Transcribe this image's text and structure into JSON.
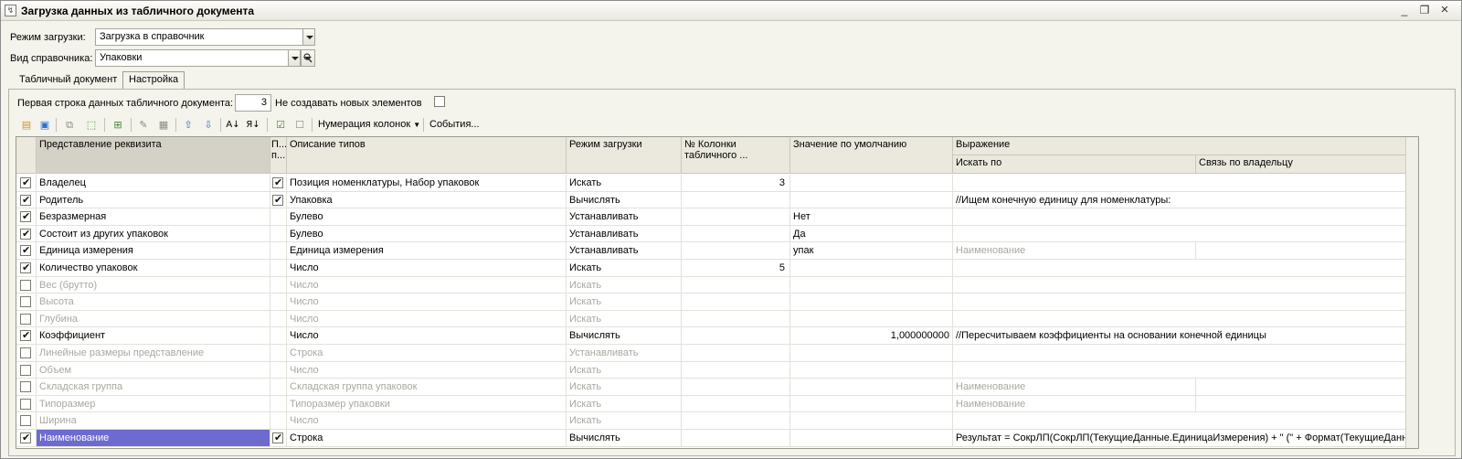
{
  "window": {
    "title": "Загрузка данных из табличного документа",
    "minimize": "_",
    "restore": "❐",
    "close": "×"
  },
  "form": {
    "load_mode_label": "Режим загрузки:",
    "load_mode_value": "Загрузка в справочник",
    "catalog_kind_label": "Вид справочника:",
    "catalog_kind_value": "Упаковки"
  },
  "tabs": [
    {
      "label": "Табличный документ",
      "active": false
    },
    {
      "label": "Настройка",
      "active": true
    }
  ],
  "settings": {
    "first_row_label": "Первая строка данных табличного документа:",
    "first_row_value": "3",
    "no_new_label": "Не создавать новых элементов",
    "no_new_checked": false
  },
  "toolbar": {
    "numbering_label": "Нумерация колонок",
    "events_label": "События..."
  },
  "table": {
    "headers": {
      "name": "Представление реквизита",
      "p": "П...",
      "p2": "п...",
      "types": "Описание типов",
      "mode": "Режим загрузки",
      "col_no": "№ Колонки",
      "col_no2": "табличного ...",
      "default": "Значение по умолчанию",
      "expr": "Выражение",
      "search_by": "Искать по",
      "owner_link": "Связь по владельцу"
    },
    "rows": [
      {
        "on": true,
        "name": "Владелец",
        "p": true,
        "types": "Позиция номенклатуры, Набор упаковок",
        "mode": "Искать",
        "col": "3",
        "def": "",
        "expr": ""
      },
      {
        "on": true,
        "name": "Родитель",
        "p": true,
        "types": "Упаковка",
        "mode": "Вычислять",
        "col": "",
        "def": "",
        "expr": "//Ищем конечную единицу для номенклатуры:"
      },
      {
        "on": true,
        "name": "Безразмерная",
        "p": false,
        "types": "Булево",
        "mode": "Устанавливать",
        "col": "",
        "def": "Нет",
        "expr": ""
      },
      {
        "on": true,
        "name": "Состоит из других упаковок",
        "p": false,
        "types": "Булево",
        "mode": "Устанавливать",
        "col": "",
        "def": "Да",
        "expr": ""
      },
      {
        "on": true,
        "name": "Единица измерения",
        "p": false,
        "types": "Единица измерения",
        "mode": "Устанавливать",
        "col": "",
        "def": "упак",
        "expr": "",
        "searchby": "Наименование",
        "searchby_dis": true
      },
      {
        "on": true,
        "name": "Количество упаковок",
        "p": false,
        "types": "Число",
        "mode": "Искать",
        "col": "5",
        "def": "",
        "expr": ""
      },
      {
        "on": false,
        "name": "Вес (брутто)",
        "p": false,
        "types": "Число",
        "mode": "Искать",
        "col": "",
        "def": "",
        "expr": ""
      },
      {
        "on": false,
        "name": "Высота",
        "p": false,
        "types": "Число",
        "mode": "Искать",
        "col": "",
        "def": "",
        "expr": ""
      },
      {
        "on": false,
        "name": "Глубина",
        "p": false,
        "types": "Число",
        "mode": "Искать",
        "col": "",
        "def": "",
        "expr": ""
      },
      {
        "on": true,
        "name": "Коэффициент",
        "p": false,
        "types": "Число",
        "mode": "Вычислять",
        "col": "",
        "def": "1,000000000",
        "expr": "//Пересчитываем коэффициенты на основании конечной единицы"
      },
      {
        "on": false,
        "name": "Линейные размеры представление",
        "p": false,
        "types": "Строка",
        "mode": "Устанавливать",
        "col": "",
        "def": "",
        "expr": ""
      },
      {
        "on": false,
        "name": "Объем",
        "p": false,
        "types": "Число",
        "mode": "Искать",
        "col": "",
        "def": "",
        "expr": ""
      },
      {
        "on": false,
        "name": "Складская группа",
        "p": false,
        "types": "Складская группа упаковок",
        "mode": "Искать",
        "col": "",
        "def": "",
        "expr": "",
        "searchby": "Наименование",
        "searchby_dis": true
      },
      {
        "on": false,
        "name": "Типоразмер",
        "p": false,
        "types": "Типоразмер упаковки",
        "mode": "Искать",
        "col": "",
        "def": "",
        "expr": "",
        "searchby": "Наименование",
        "searchby_dis": true
      },
      {
        "on": false,
        "name": "Ширина",
        "p": false,
        "types": "Число",
        "mode": "Искать",
        "col": "",
        "def": "",
        "expr": ""
      },
      {
        "on": true,
        "name": "Наименование",
        "p": true,
        "types": "Строка",
        "mode": "Вычислять",
        "col": "",
        "def": "",
        "expr": "Результат = СокрЛП(СокрЛП(ТекущиеДанные.ЕдиницаИзмерения) + \" (\" + Формат(ТекущиеДанные....",
        "selected": true
      }
    ]
  }
}
